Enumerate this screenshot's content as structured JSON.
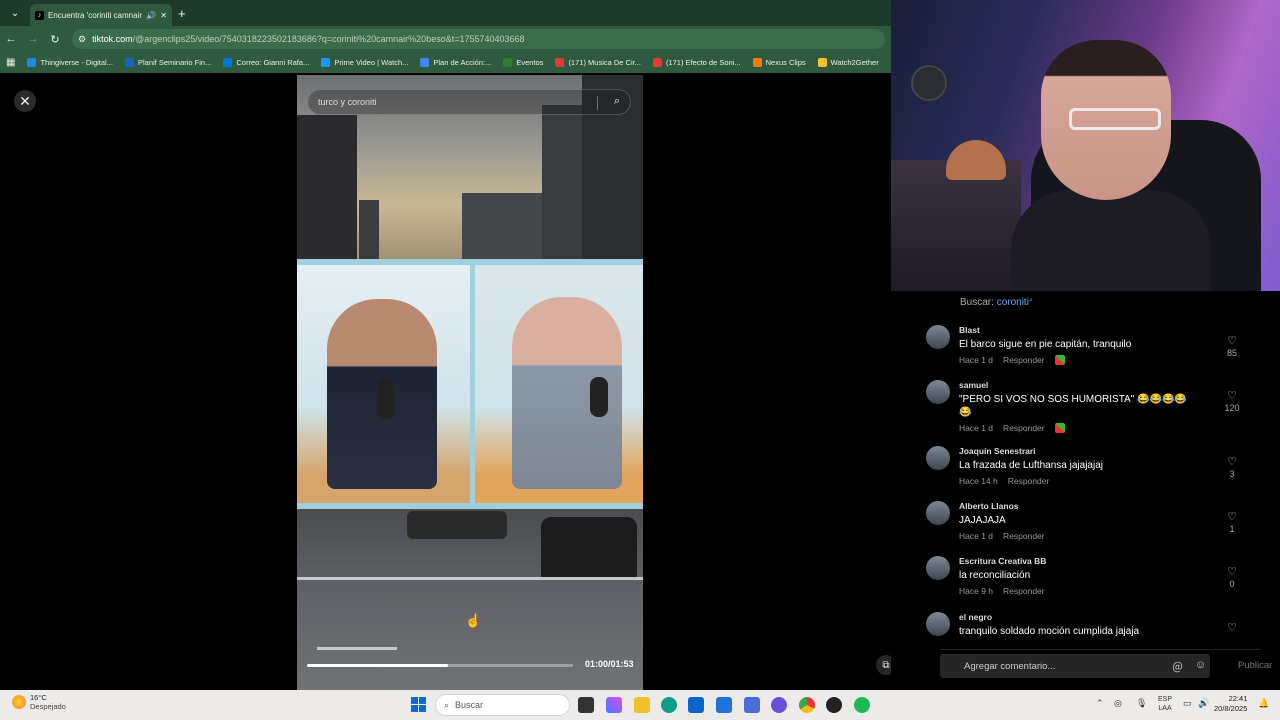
{
  "browser": {
    "tab_title": "Encuentra 'coriniti camnair'",
    "tab_favicon": "tiktok-icon",
    "url_host": "tiktok.com",
    "url_path": "/@argenclips25/video/7540318223502183686?q=coriniti%20camnair%20beso&t=1755740403668",
    "bookmarks": [
      {
        "label": "Thingiverse - Digital...",
        "color": "#1e88e5"
      },
      {
        "label": "Planif Seminario Fin...",
        "color": "#1565c0"
      },
      {
        "label": "Correo: Gianni Rafa...",
        "color": "#0078d4"
      },
      {
        "label": "Prime Video | Watch...",
        "color": "#1a98ff"
      },
      {
        "label": "Plan de Acción:...",
        "color": "#4285f4"
      },
      {
        "label": "Eventos",
        "color": "#2e7d32"
      },
      {
        "label": "(171) Musica De Cir...",
        "color": "#e53935"
      },
      {
        "label": "(171) Efecto de Soni...",
        "color": "#e53935"
      },
      {
        "label": "Nexus Clips",
        "color": "#f57c00"
      },
      {
        "label": "Watch2Gether",
        "color": "#fbc02d"
      }
    ]
  },
  "video": {
    "search_placeholder": "turco y coroniti",
    "time": "01:00/01:53",
    "progress": 0.53
  },
  "comments": {
    "search_label": "Buscar:",
    "search_term": "coroniti",
    "items": [
      {
        "user": "Blast",
        "text": "El barco sigue en pie capitán, tranquilo",
        "age": "Hace 1 d",
        "reply": "Responder",
        "likes": "85",
        "badge": true
      },
      {
        "user": "samuel",
        "text": "\"PERO SI VOS NO SOS HUMORISTA\" 😂😂😂😂😂",
        "age": "Hace 1 d",
        "reply": "Responder",
        "likes": "120",
        "badge": true
      },
      {
        "user": "Joaquín Senestrari",
        "text": "La frazada de Lufthansa jajajajaj",
        "age": "Hace 14 h",
        "reply": "Responder",
        "likes": "3",
        "badge": false
      },
      {
        "user": "Alberto Llanos",
        "text": "JAJAJAJA",
        "age": "Hace 1 d",
        "reply": "Responder",
        "likes": "1",
        "badge": false
      },
      {
        "user": "Escritura Creativa BB",
        "text": "la reconciliación",
        "age": "Hace 9 h",
        "reply": "Responder",
        "likes": "0",
        "badge": false
      },
      {
        "user": "el negro",
        "text": "tranquilo soldado moción cumplida jajaja",
        "age": "",
        "reply": "",
        "likes": "",
        "badge": false
      }
    ],
    "composer_placeholder": "Agregar comentario...",
    "publish_label": "Publicar"
  },
  "taskbar": {
    "weather_temp": "16°C",
    "weather_desc": "Despejado",
    "search_placeholder": "Buscar",
    "lang_top": "ESP",
    "lang_bottom": "LAA",
    "time": "22:41",
    "date": "20/8/2025"
  }
}
